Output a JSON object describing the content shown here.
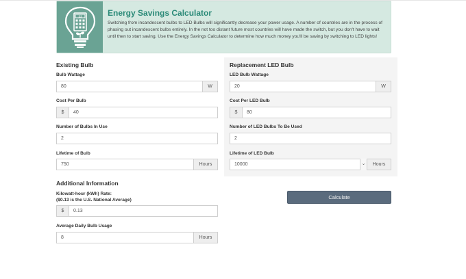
{
  "banner": {
    "title": "Energy Savings Calculator",
    "description": "Switching from incandescent bulbs to LED Bulbs will significantly decrease your power usage. A number of countries are in the process of phasing out incandescent bulbs entirely. In the not too distant future most countries will have made the switch, but you don't have to wait until then to start saving. Use the Energy Savings Calculator to determine how much money you'll be saving by switching to LED lights!",
    "icon": "lightbulb-calculator-icon",
    "icon_color": "#6aa394",
    "title_color": "#2b8a78"
  },
  "existing": {
    "heading": "Existing Bulb",
    "wattage": {
      "label": "Bulb Wattage",
      "value": "80",
      "unit": "W"
    },
    "cost": {
      "label": "Cost Per Bulb",
      "prefix": "$",
      "value": "40"
    },
    "count": {
      "label": "Number of Bulbs In Use",
      "value": "2"
    },
    "lifetime": {
      "label": "Lifetime of Bulb",
      "value": "750",
      "unit": "Hours"
    }
  },
  "replacement": {
    "heading": "Replacement LED Bulb",
    "wattage": {
      "label": "LED Bulb Wattage",
      "value": "20",
      "unit": "W"
    },
    "cost": {
      "label": "Cost Per LED Bulb",
      "prefix": "$",
      "value": "80"
    },
    "count": {
      "label": "Number of LED Bulbs To Be Used",
      "value": "2"
    },
    "lifetime": {
      "label": "Lifetime of LED Bulb",
      "value": "10000",
      "unit": "Hours",
      "caret": "⌄"
    }
  },
  "additional": {
    "heading": "Additional Information",
    "rate": {
      "label_line1": "Kilowatt-hour (kWh) Rate:",
      "label_line2": "($0.13 is the U.S. National Average)",
      "prefix": "$",
      "value": "0.13"
    },
    "usage": {
      "label": "Average Daily Bulb Usage",
      "value": "8",
      "unit": "Hours"
    }
  },
  "actions": {
    "calculate_label": "Calculate",
    "button_color": "#5a6b7d"
  }
}
